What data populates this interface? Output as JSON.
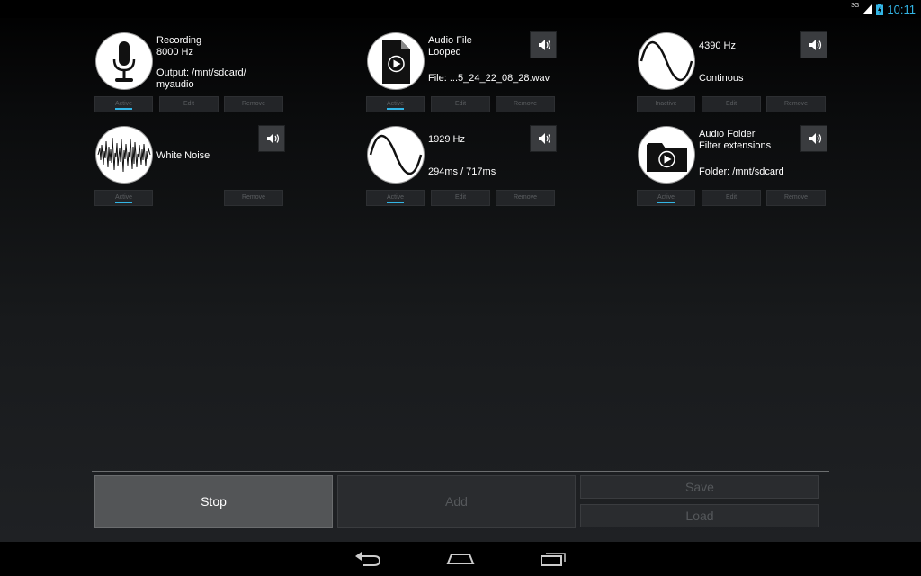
{
  "status_bar": {
    "network": "3G",
    "time": "10:11"
  },
  "sources": [
    {
      "lines": [
        "Recording",
        "8000 Hz"
      ],
      "lines2": [
        "Output: /mnt/sdcard/",
        "myaudio"
      ],
      "speaker": false,
      "buttons": {
        "toggle": "Active",
        "edit": "Edit",
        "remove": "Remove"
      },
      "toggle_state": "active"
    },
    {
      "lines": [
        "Audio File",
        "Looped"
      ],
      "lines2": [
        "File: ...5_24_22_08_28.wav"
      ],
      "speaker": true,
      "buttons": {
        "toggle": "Active",
        "edit": "Edit",
        "remove": "Remove"
      },
      "toggle_state": "active"
    },
    {
      "lines": [
        "4390 Hz"
      ],
      "lines2": [
        "Continous"
      ],
      "speaker": true,
      "buttons": {
        "toggle": "Inactive",
        "edit": "Edit",
        "remove": "Remove"
      },
      "toggle_state": "inactive"
    },
    {
      "lines": [
        "White Noise"
      ],
      "lines2": [],
      "speaker": true,
      "buttons": {
        "toggle": "Active",
        "edit": "",
        "remove": "Remove"
      },
      "toggle_state": "active"
    },
    {
      "lines": [
        "1929 Hz"
      ],
      "lines2": [
        "294ms / 717ms"
      ],
      "speaker": true,
      "buttons": {
        "toggle": "Active",
        "edit": "Edit",
        "remove": "Remove"
      },
      "toggle_state": "active"
    },
    {
      "lines": [
        "Audio Folder",
        "Filter extensions"
      ],
      "lines2": [
        "Folder: /mnt/sdcard"
      ],
      "speaker": true,
      "buttons": {
        "toggle": "Active",
        "edit": "Edit",
        "remove": "Remove"
      },
      "toggle_state": "active"
    }
  ],
  "bottom": {
    "stop": "Stop",
    "add": "Add",
    "save": "Save",
    "load": "Load"
  },
  "icons": {
    "speaker": "speaker-icon",
    "microphone": "microphone-icon",
    "file": "audio-file-icon",
    "sine": "sine-wave-icon",
    "noise": "white-noise-icon",
    "folder": "audio-folder-icon",
    "back": "back-icon",
    "home": "home-icon",
    "recents": "recent-apps-icon"
  },
  "colors": {
    "accent": "#33b5e5",
    "background": "#1b1d1f"
  }
}
